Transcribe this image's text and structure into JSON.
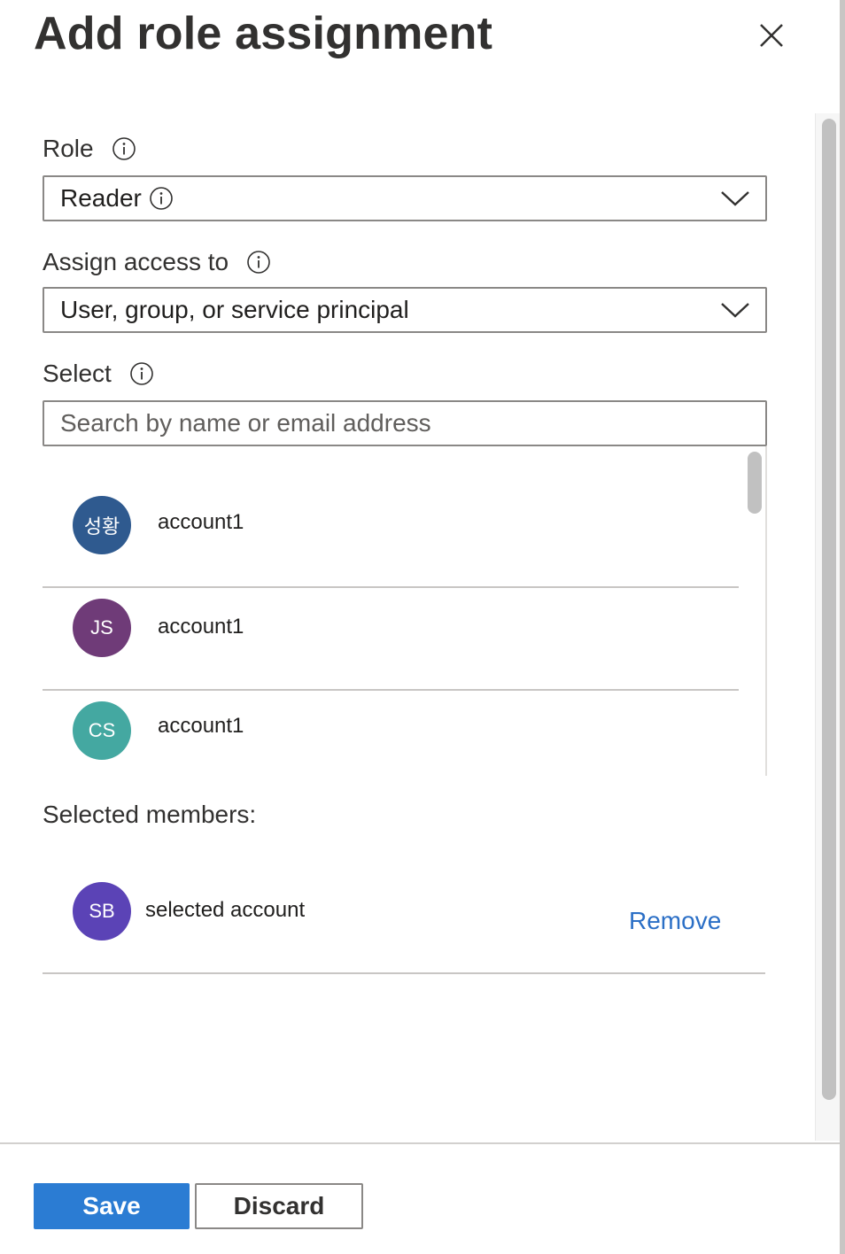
{
  "panel": {
    "title": "Add role assignment"
  },
  "role": {
    "label": "Role",
    "value": "Reader"
  },
  "assign_access": {
    "label": "Assign access to",
    "value": "User, group, or service principal"
  },
  "select": {
    "label": "Select",
    "placeholder": "Search by name or email address",
    "results": [
      {
        "initials": "성황",
        "name": "account1",
        "avatar_color": "#2f5a8f"
      },
      {
        "initials": "JS",
        "name": "account1",
        "avatar_color": "#6f3b78"
      },
      {
        "initials": "CS",
        "name": "account1",
        "avatar_color": "#44a8a1"
      }
    ]
  },
  "selected_members": {
    "heading": "Selected members:",
    "items": [
      {
        "initials": "SB",
        "name": "selected account",
        "avatar_color": "#5b43b6",
        "remove_label": "Remove"
      }
    ]
  },
  "footer": {
    "save_label": "Save",
    "discard_label": "Discard"
  },
  "icons": {
    "close": "close-icon",
    "info": "info-icon",
    "chevron": "chevron-down-icon"
  },
  "colors": {
    "primary": "#2b7cd3",
    "link": "#2b6fc6",
    "border": "#8a8886"
  }
}
